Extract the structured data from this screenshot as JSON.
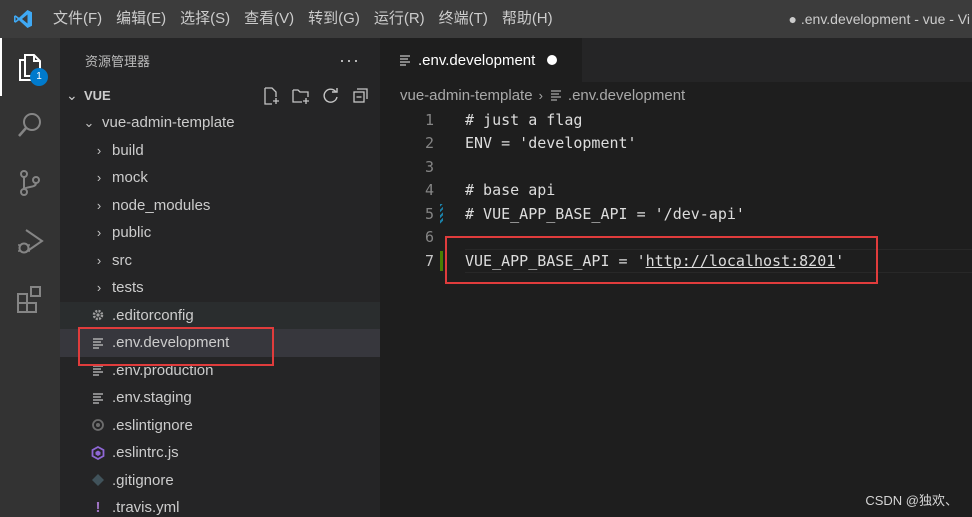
{
  "titlebar": {
    "menu": [
      "文件(F)",
      "编辑(E)",
      "选择(S)",
      "查看(V)",
      "转到(G)",
      "运行(R)",
      "终端(T)",
      "帮助(H)"
    ],
    "window_title": "● .env.development - vue - Vi"
  },
  "activitybar": {
    "items": [
      {
        "icon": "files-icon",
        "badge": "1"
      },
      {
        "icon": "search-icon"
      },
      {
        "icon": "source-control-icon"
      },
      {
        "icon": "run-debug-icon"
      },
      {
        "icon": "extensions-icon"
      }
    ],
    "accent": "#007acc"
  },
  "sidebar": {
    "title": "资源管理器",
    "more": "···",
    "section": "VUE",
    "actions": [
      "new-file-icon",
      "new-folder-icon",
      "refresh-icon",
      "collapse-all-icon"
    ],
    "root": "vue-admin-template",
    "items": [
      {
        "label": "build",
        "type": "folder"
      },
      {
        "label": "mock",
        "type": "folder"
      },
      {
        "label": "node_modules",
        "type": "folder"
      },
      {
        "label": "public",
        "type": "folder"
      },
      {
        "label": "src",
        "type": "folder"
      },
      {
        "label": "tests",
        "type": "folder"
      },
      {
        "label": ".editorconfig",
        "type": "gear-file"
      },
      {
        "label": ".env.development",
        "type": "text-file"
      },
      {
        "label": ".env.production",
        "type": "text-file"
      },
      {
        "label": ".env.staging",
        "type": "text-file"
      },
      {
        "label": ".eslintignore",
        "type": "circle-file"
      },
      {
        "label": ".eslintrc.js",
        "type": "eslint-file"
      },
      {
        "label": ".gitignore",
        "type": "git-file"
      },
      {
        "label": ".travis.yml",
        "type": "yaml-file"
      }
    ]
  },
  "editor": {
    "tab": ".env.development",
    "breadcrumb": [
      "vue-admin-template",
      ".env.development"
    ],
    "lines": [
      {
        "n": "1",
        "text": "# just a flag"
      },
      {
        "n": "2",
        "text": "ENV = 'development'"
      },
      {
        "n": "3",
        "text": ""
      },
      {
        "n": "4",
        "text": "# base api"
      },
      {
        "n": "5",
        "text": "# VUE_APP_BASE_API = '/dev-api'"
      },
      {
        "n": "6",
        "text": ""
      },
      {
        "n": "7",
        "pre": "VUE_APP_BASE_API = '",
        "link": "http://localhost:8201",
        "post": "'"
      }
    ]
  },
  "watermark": "CSDN @独欢、"
}
